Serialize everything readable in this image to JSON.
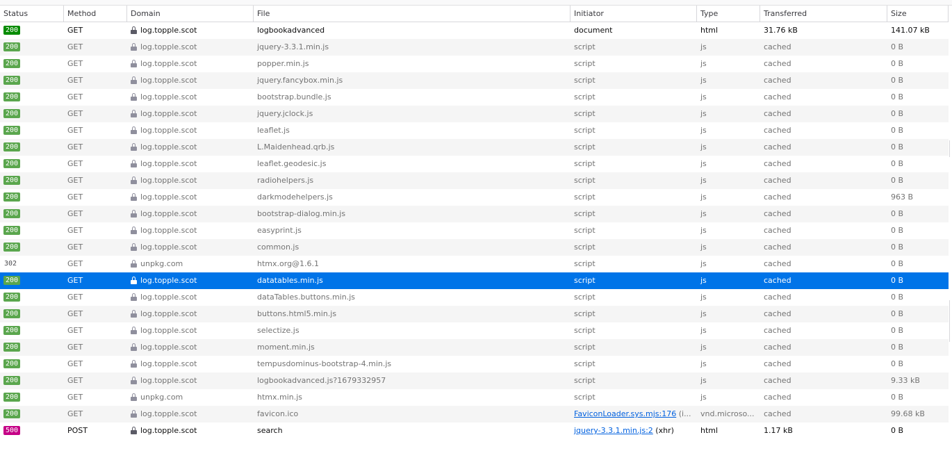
{
  "columns": {
    "status": "Status",
    "method": "Method",
    "domain": "Domain",
    "file": "File",
    "initiator": "Initiator",
    "type": "Type",
    "transferred": "Transferred",
    "size": "Size"
  },
  "colors": {
    "selected_row": "#0074e8",
    "status_ok": "#058b00",
    "status_cached": "#5aa64d",
    "status_error": "#c50086",
    "link": "#0060df"
  },
  "selected_index": 15,
  "requests": [
    {
      "status": "200",
      "badge": "ok",
      "method": "GET",
      "secure": true,
      "domain": "log.topple.scot",
      "file": "logbookadvanced",
      "initiator": "document",
      "type": "html",
      "transferred": "31.76 kB",
      "size": "141.07 kB",
      "main": true
    },
    {
      "status": "200",
      "badge": "cached",
      "method": "GET",
      "secure": true,
      "domain": "log.topple.scot",
      "file": "jquery-3.3.1.min.js",
      "initiator": "script",
      "type": "js",
      "transferred": "cached",
      "size": "0 B"
    },
    {
      "status": "200",
      "badge": "cached",
      "method": "GET",
      "secure": true,
      "domain": "log.topple.scot",
      "file": "popper.min.js",
      "initiator": "script",
      "type": "js",
      "transferred": "cached",
      "size": "0 B"
    },
    {
      "status": "200",
      "badge": "cached",
      "method": "GET",
      "secure": true,
      "domain": "log.topple.scot",
      "file": "jquery.fancybox.min.js",
      "initiator": "script",
      "type": "js",
      "transferred": "cached",
      "size": "0 B"
    },
    {
      "status": "200",
      "badge": "cached",
      "method": "GET",
      "secure": true,
      "domain": "log.topple.scot",
      "file": "bootstrap.bundle.js",
      "initiator": "script",
      "type": "js",
      "transferred": "cached",
      "size": "0 B"
    },
    {
      "status": "200",
      "badge": "cached",
      "method": "GET",
      "secure": true,
      "domain": "log.topple.scot",
      "file": "jquery.jclock.js",
      "initiator": "script",
      "type": "js",
      "transferred": "cached",
      "size": "0 B"
    },
    {
      "status": "200",
      "badge": "cached",
      "method": "GET",
      "secure": true,
      "domain": "log.topple.scot",
      "file": "leaflet.js",
      "initiator": "script",
      "type": "js",
      "transferred": "cached",
      "size": "0 B"
    },
    {
      "status": "200",
      "badge": "cached",
      "method": "GET",
      "secure": true,
      "domain": "log.topple.scot",
      "file": "L.Maidenhead.qrb.js",
      "initiator": "script",
      "type": "js",
      "transferred": "cached",
      "size": "0 B"
    },
    {
      "status": "200",
      "badge": "cached",
      "method": "GET",
      "secure": true,
      "domain": "log.topple.scot",
      "file": "leaflet.geodesic.js",
      "initiator": "script",
      "type": "js",
      "transferred": "cached",
      "size": "0 B"
    },
    {
      "status": "200",
      "badge": "cached",
      "method": "GET",
      "secure": true,
      "domain": "log.topple.scot",
      "file": "radiohelpers.js",
      "initiator": "script",
      "type": "js",
      "transferred": "cached",
      "size": "0 B"
    },
    {
      "status": "200",
      "badge": "cached",
      "method": "GET",
      "secure": true,
      "domain": "log.topple.scot",
      "file": "darkmodehelpers.js",
      "initiator": "script",
      "type": "js",
      "transferred": "cached",
      "size": "963 B"
    },
    {
      "status": "200",
      "badge": "cached",
      "method": "GET",
      "secure": true,
      "domain": "log.topple.scot",
      "file": "bootstrap-dialog.min.js",
      "initiator": "script",
      "type": "js",
      "transferred": "cached",
      "size": "0 B"
    },
    {
      "status": "200",
      "badge": "cached",
      "method": "GET",
      "secure": true,
      "domain": "log.topple.scot",
      "file": "easyprint.js",
      "initiator": "script",
      "type": "js",
      "transferred": "cached",
      "size": "0 B"
    },
    {
      "status": "200",
      "badge": "cached",
      "method": "GET",
      "secure": true,
      "domain": "log.topple.scot",
      "file": "common.js",
      "initiator": "script",
      "type": "js",
      "transferred": "cached",
      "size": "0 B"
    },
    {
      "status": "302",
      "badge": "redirect",
      "method": "GET",
      "secure": true,
      "domain": "unpkg.com",
      "file": "htmx.org@1.6.1",
      "initiator": "script",
      "type": "js",
      "transferred": "cached",
      "size": "0 B"
    },
    {
      "status": "200",
      "badge": "cached",
      "method": "GET",
      "secure": true,
      "domain": "log.topple.scot",
      "file": "datatables.min.js",
      "initiator": "script",
      "type": "js",
      "transferred": "cached",
      "size": "0 B"
    },
    {
      "status": "200",
      "badge": "cached",
      "method": "GET",
      "secure": true,
      "domain": "log.topple.scot",
      "file": "dataTables.buttons.min.js",
      "initiator": "script",
      "type": "js",
      "transferred": "cached",
      "size": "0 B"
    },
    {
      "status": "200",
      "badge": "cached",
      "method": "GET",
      "secure": true,
      "domain": "log.topple.scot",
      "file": "buttons.html5.min.js",
      "initiator": "script",
      "type": "js",
      "transferred": "cached",
      "size": "0 B"
    },
    {
      "status": "200",
      "badge": "cached",
      "method": "GET",
      "secure": true,
      "domain": "log.topple.scot",
      "file": "selectize.js",
      "initiator": "script",
      "type": "js",
      "transferred": "cached",
      "size": "0 B"
    },
    {
      "status": "200",
      "badge": "cached",
      "method": "GET",
      "secure": true,
      "domain": "log.topple.scot",
      "file": "moment.min.js",
      "initiator": "script",
      "type": "js",
      "transferred": "cached",
      "size": "0 B"
    },
    {
      "status": "200",
      "badge": "cached",
      "method": "GET",
      "secure": true,
      "domain": "log.topple.scot",
      "file": "tempusdominus-bootstrap-4.min.js",
      "initiator": "script",
      "type": "js",
      "transferred": "cached",
      "size": "0 B"
    },
    {
      "status": "200",
      "badge": "cached",
      "method": "GET",
      "secure": true,
      "domain": "log.topple.scot",
      "file": "logbookadvanced.js?1679332957",
      "initiator": "script",
      "type": "js",
      "transferred": "cached",
      "size": "9.33 kB"
    },
    {
      "status": "200",
      "badge": "cached",
      "method": "GET",
      "secure": true,
      "domain": "unpkg.com",
      "file": "htmx.min.js",
      "initiator": "script",
      "type": "js",
      "transferred": "cached",
      "size": "0 B"
    },
    {
      "status": "200",
      "badge": "cached",
      "method": "GET",
      "secure": true,
      "domain": "log.topple.scot",
      "file": "favicon.ico",
      "initiator_link": "FaviconLoader.sys.mjs:176",
      "initiator_suffix": " (i...",
      "type": "vnd.microso...",
      "transferred": "cached",
      "size": "99.68 kB"
    },
    {
      "status": "500",
      "badge": "err",
      "method": "POST",
      "secure": true,
      "domain": "log.topple.scot",
      "file": "search",
      "initiator_link": "jquery-3.3.1.min.js:2",
      "initiator_suffix": " (xhr)",
      "type": "html",
      "transferred": "1.17 kB",
      "size": "0 B",
      "main": true
    }
  ]
}
